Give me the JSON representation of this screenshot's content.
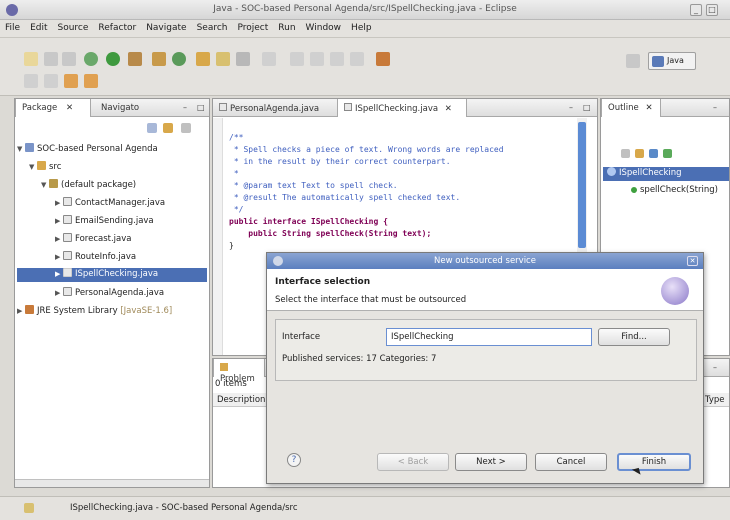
{
  "window": {
    "title": "Java - SOC-based Personal Agenda/src/ISpellChecking.java - Eclipse"
  },
  "menu": [
    "File",
    "Edit",
    "Source",
    "Refactor",
    "Navigate",
    "Search",
    "Project",
    "Run",
    "Window",
    "Help"
  ],
  "toolbar": {
    "perspective_label": "Java"
  },
  "package_explorer": {
    "tabs": [
      "Package",
      "Navigato"
    ],
    "tree": [
      {
        "label": "SOC-based Personal Agenda",
        "icon": "project-icon"
      },
      {
        "label": "src",
        "icon": "source-folder-icon"
      },
      {
        "label": "(default package)",
        "icon": "package-icon"
      },
      {
        "label": "ContactManager.java",
        "icon": "java-file-icon"
      },
      {
        "label": "EmailSending.java",
        "icon": "java-file-icon"
      },
      {
        "label": "Forecast.java",
        "icon": "java-file-icon"
      },
      {
        "label": "RouteInfo.java",
        "icon": "java-file-icon"
      },
      {
        "label": "ISpellChecking.java",
        "icon": "java-file-icon",
        "selected": true
      },
      {
        "label": "PersonalAgenda.java",
        "icon": "java-file-icon"
      },
      {
        "label": "JRE System Library",
        "icon": "library-icon",
        "suffix": "[JavaSE-1.6]"
      }
    ]
  },
  "editor": {
    "tabs": [
      "PersonalAgenda.java",
      "ISpellChecking.java"
    ],
    "lines": [
      "/**",
      " * Spell checks a piece of text. Wrong words are replaced",
      " * in the result by their correct counterpart.",
      " *",
      " * @param text Text to spell check.",
      " * @result The automatically spell checked text.",
      " */",
      "public interface ISpellChecking {",
      "    public String spellCheck(String text);",
      "}"
    ]
  },
  "outline": {
    "tab": "Outline",
    "items": [
      "ISpellChecking",
      "spellCheck(String)"
    ]
  },
  "problems": {
    "tab": "Problem",
    "count": "0 items",
    "column_description": "Description",
    "column_type": "Type"
  },
  "dialog": {
    "title": "New outsourced service",
    "header_title": "Interface selection",
    "header_desc": "Select the interface that must be outsourced",
    "interface_label": "Interface",
    "interface_value": "ISpellChecking",
    "find_label": "Find...",
    "published": "Published services: 17  Categories: 7",
    "back_label": "< Back",
    "next_label": "Next >",
    "cancel_label": "Cancel",
    "finish_label": "Finish"
  },
  "status": {
    "text": "ISpellChecking.java - SOC-based Personal Agenda/src"
  },
  "colors": {
    "selection": "#4b6fb4",
    "dialog_title": "#5b7fbf",
    "keyword": "#7f0055",
    "comment": "#3f5fbf"
  }
}
